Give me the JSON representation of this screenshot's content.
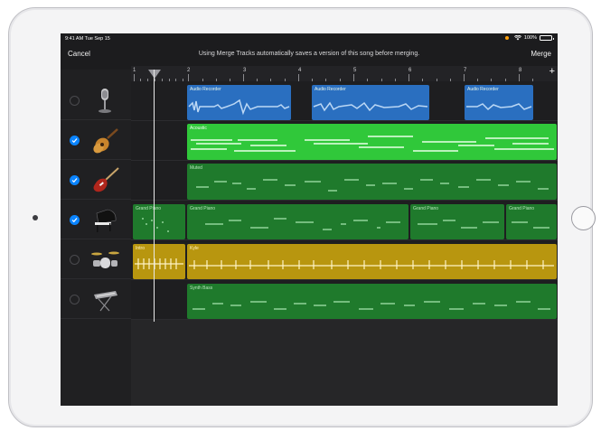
{
  "statusbar": {
    "time": "9:41 AM  Tue Sep 15",
    "battery": "100%"
  },
  "navbar": {
    "cancel": "Cancel",
    "message": "Using Merge Tracks automatically saves a version of this song before merging.",
    "merge": "Merge"
  },
  "ruler": {
    "bars": [
      "1",
      "2",
      "3",
      "4",
      "5",
      "6",
      "7",
      "8"
    ],
    "add": "+"
  },
  "tracks": [
    {
      "instrument": "microphone-icon",
      "selected": false
    },
    {
      "instrument": "acoustic-guitar-icon",
      "selected": true
    },
    {
      "instrument": "electric-guitar-icon",
      "selected": true
    },
    {
      "instrument": "grand-piano-icon",
      "selected": true
    },
    {
      "instrument": "drum-kit-icon",
      "selected": false
    },
    {
      "instrument": "keyboard-icon",
      "selected": false
    }
  ],
  "regions": {
    "audio1": "Audio Recorder",
    "audio2": "Audio Recorder",
    "audio3": "Audio Recorder",
    "acoustic": "Acoustic",
    "muted": "Muted",
    "piano1": "Grand Piano",
    "piano2": "Grand Piano",
    "piano3": "Grand Piano",
    "piano4": "Grand Piano",
    "intro": "Intro",
    "kyle": "Kyle",
    "synth": "Synth Bass"
  },
  "colors": {
    "audio": "#2a6fc0",
    "green_bright": "#30c83a",
    "green_dark": "#1f7a2c",
    "drums": "#b8960f",
    "checkbox": "#0a84ff"
  }
}
